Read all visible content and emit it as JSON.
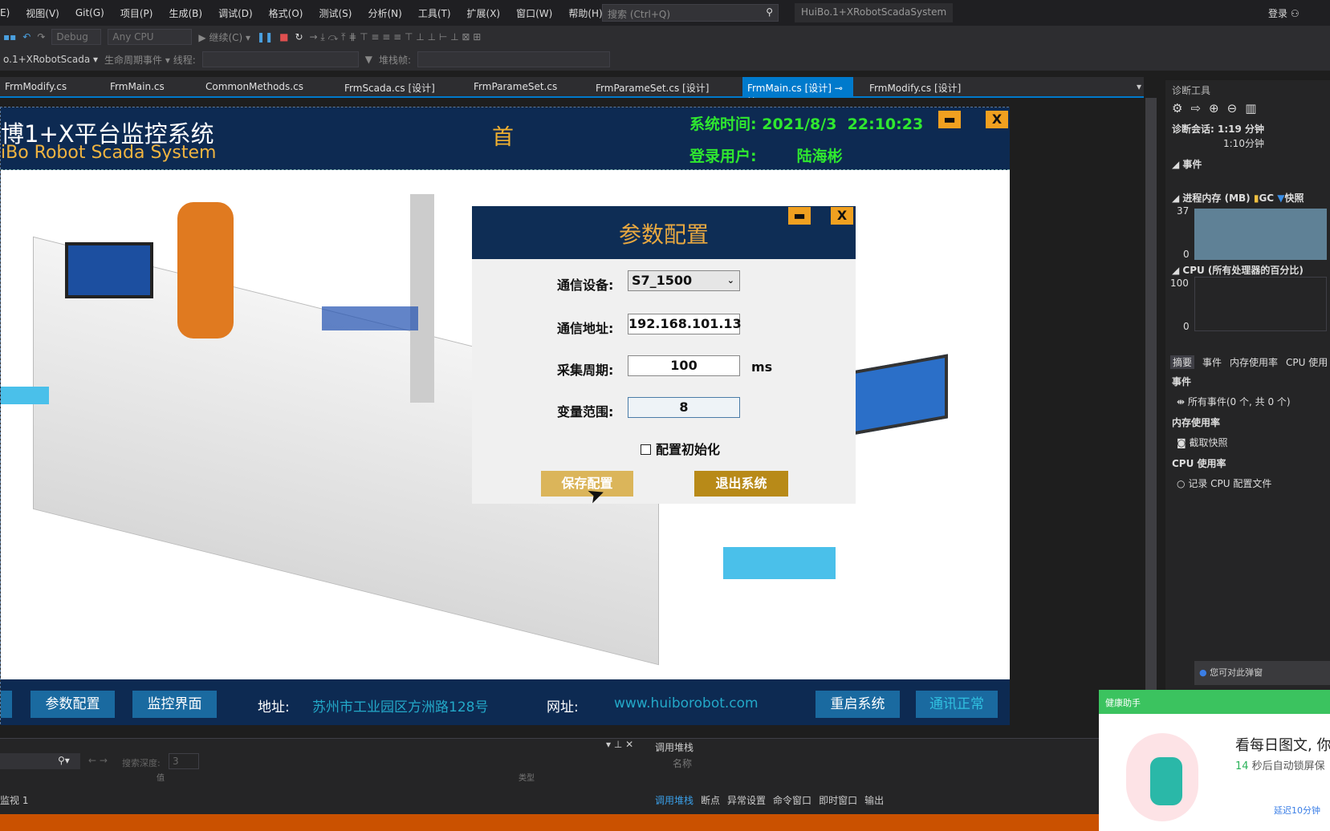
{
  "menu": {
    "items": [
      "E)",
      "视图(V)",
      "Git(G)",
      "项目(P)",
      "生成(B)",
      "调试(D)",
      "格式(O)",
      "测试(S)",
      "分析(N)",
      "工具(T)",
      "扩展(X)",
      "窗口(W)",
      "帮助(H)"
    ],
    "search_placeholder": "搜索 (Ctrl+Q)",
    "solution": "HuiBo.1+XRobotScadaSystem",
    "login": "登录"
  },
  "toolbar": {
    "config": "Debug",
    "platform": "Any CPU",
    "continue": "继续(C) ▾",
    "project": "o.1+XRobotScada ▾",
    "lifecycle": "生命周期事件 ▾ 线程:",
    "stackframe": "堆栈帧:"
  },
  "tabs": [
    "FrmModify.cs",
    "FrmMain.cs",
    "CommonMethods.cs",
    "FrmScada.cs [设计]",
    "FrmParameSet.cs",
    "FrmParameSet.cs [设计]",
    "FrmMain.cs [设计]",
    "FrmModify.cs [设计]"
  ],
  "active_tab": 6,
  "scada": {
    "title_cn": "博1+X平台监控系统",
    "title_en": "iBo Robot Scada System",
    "home": "首",
    "time_label": "系统时间:",
    "date": "2021/8/3",
    "time": "22:10:23",
    "user_label": "登录用户:",
    "user": "陆海彬",
    "min": "▬",
    "close": "X",
    "footer": {
      "param_btn": "参数配置",
      "monitor_btn": "监控界面",
      "address_label": "地址:",
      "address": "苏州市工业园区方洲路128号",
      "web_label": "网址:",
      "web": "www.huiborobot.com",
      "restart_btn": "重启系统",
      "comm_status": "通讯正常"
    }
  },
  "dialog": {
    "title": "参数配置",
    "device_label": "通信设备:",
    "device": "S7_1500",
    "address_label": "通信地址:",
    "address": "192.168.101.13",
    "period_label": "采集周期:",
    "period": "100",
    "period_unit": "ms",
    "range_label": "变量范围:",
    "range": "8",
    "init_label": "配置初始化",
    "init_checked": false,
    "save": "保存配置",
    "exit": "退出系统"
  },
  "diag": {
    "title": "诊断工具",
    "session": "诊断会话: 1:19 分钟",
    "tick": "1:10分钟",
    "events": "事件",
    "memory": "进程内存 (MB)",
    "gc": "GC",
    "snapshot": "快照",
    "mem_max": "37",
    "mem_min": "0",
    "cpu": "CPU (所有处理器的百分比)",
    "cpu_max": "100",
    "cpu_min": "0",
    "tabs": [
      "摘要",
      "事件",
      "内存使用率",
      "CPU 使用"
    ],
    "sec_events": "事件",
    "all_events": "所有事件(0 个, 共 0 个)",
    "sec_mem": "内存使用率",
    "take_snapshot": "截取快照",
    "sec_cpu": "CPU 使用率",
    "record_cpu": "记录 CPU 配置文件",
    "tip": "您可对此弹窗"
  },
  "health": {
    "title": "健康助手",
    "headline": "看每日图文, 你",
    "countdown": "14",
    "countdown_text": " 秒后自动锁屏保",
    "delay": "延迟10分钟"
  },
  "bottom": {
    "search_depth": "搜索深度:",
    "depth": "3",
    "col_value": "值",
    "col_type": "类型",
    "watch_tab": "监视 1",
    "callstack_title": "调用堆栈",
    "col_name": "名称",
    "tabs": [
      "调用堆栈",
      "断点",
      "异常设置",
      "命令窗口",
      "即时窗口",
      "输出"
    ]
  }
}
